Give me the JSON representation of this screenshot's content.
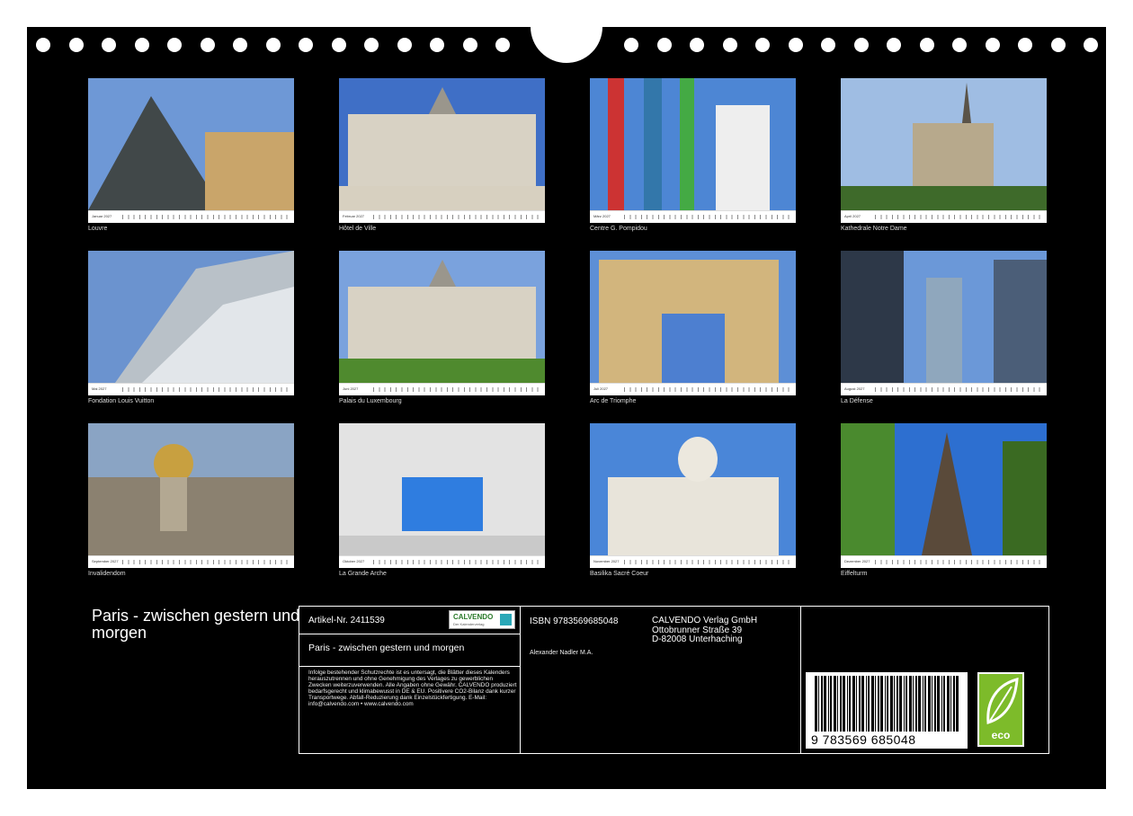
{
  "photos": [
    {
      "month": "Januar 2027",
      "caption": "Louvre",
      "sky": "#6e98d6",
      "ground": "#8a7a55",
      "icon": "pyramid-icon"
    },
    {
      "month": "Februar 2027",
      "caption": "Hôtel de Ville",
      "sky": "#3f6fc6",
      "ground": "#d7d0c0",
      "icon": "palace-icon"
    },
    {
      "month": "März 2027",
      "caption": "Centre G. Pompidou",
      "sky": "#4d86d4",
      "ground": "#d9d9d9",
      "icon": "pipes-icon"
    },
    {
      "month": "April 2027",
      "caption": "Kathedrale Notre Dame",
      "sky": "#9fbde3",
      "ground": "#3e6a2a",
      "icon": "cathedral-icon"
    },
    {
      "month": "Mai 2027",
      "caption": "Fondation Louis Vuitton",
      "sky": "#6b93cf",
      "ground": "#b9c1c8",
      "icon": "glass-sails-icon"
    },
    {
      "month": "Juni 2027",
      "caption": "Palais du Luxembourg",
      "sky": "#7aa2dd",
      "ground": "#4f8a2e",
      "icon": "palace-icon"
    },
    {
      "month": "Juli 2027",
      "caption": "Arc de Triomphe",
      "sky": "#5d8fd6",
      "ground": "#d2b57d",
      "icon": "arch-icon"
    },
    {
      "month": "August 2027",
      "caption": "La Défense",
      "sky": "#6b98d8",
      "ground": "#3d4f66",
      "icon": "towers-icon"
    },
    {
      "month": "September 2027",
      "caption": "Invalidendom",
      "sky": "#8aa4c4",
      "ground": "#8b8170",
      "icon": "dome-icon"
    },
    {
      "month": "Oktober 2027",
      "caption": "La Grande Arche",
      "sky": "#2f7de0",
      "ground": "#e3e3e3",
      "icon": "grande-arche-icon"
    },
    {
      "month": "November 2027",
      "caption": "Basilika Sacré Coeur",
      "sky": "#4a86d8",
      "ground": "#e8e4da",
      "icon": "basilica-icon"
    },
    {
      "month": "Dezember 2027",
      "caption": "Eiffelturm",
      "sky": "#2d6fd0",
      "ground": "#3f7a2a",
      "icon": "eiffel-tower-icon"
    }
  ],
  "title": "Paris - zwischen gestern und morgen",
  "info": {
    "article": "Artikel-Nr. 2411539",
    "logo": "CALVENDO",
    "logo_sub": "Der Kalenderverlag",
    "subtitle": "Paris - zwischen gestern und morgen",
    "legal": "Infolge bestehender Schutzrechte ist es untersagt, die Blätter dieses Kalenders herauszutrennen und ohne Genehmigung des Verlages zu gewerblichen Zwecken weiterzuverwenden. Alle Angaben ohne Gewähr. CALVENDO produziert bedarfsgerecht und klimabewusst in DE & EU. Positivere CO2-Bilanz dank kurzer Transportwege. Abfall-Reduzierung dank Einzelstückfertigung. E-Mail: info@calvendo.com • www.calvendo.com",
    "isbn": "ISBN 9783569685048",
    "author": "Alexander Nadler M.A.",
    "publisher_name": "CALVENDO Verlag GmbH",
    "publisher_street": "Ottobrunner Straße 39",
    "publisher_city": "D-82008 Unterhaching",
    "barcode_number": "9 783569 685048",
    "eco_label": "eco"
  },
  "colors": {
    "background": "#000000",
    "accent_green": "#7dbb2a",
    "text": "#ffffff"
  }
}
